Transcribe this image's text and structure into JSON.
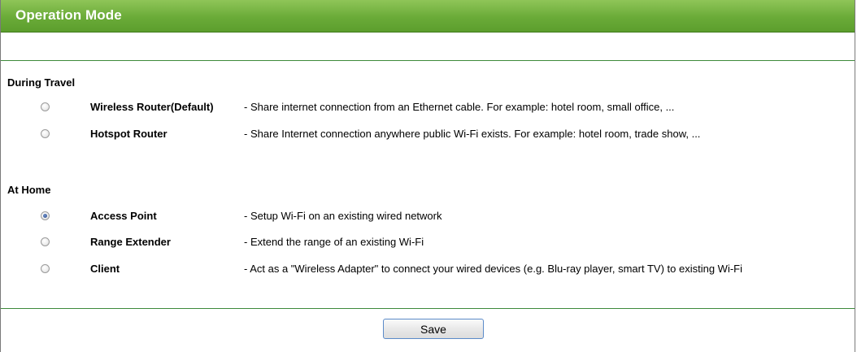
{
  "header": {
    "title": "Operation Mode"
  },
  "sections": [
    {
      "label": "During Travel",
      "options": [
        {
          "name": "Wireless Router(Default)",
          "description": "- Share internet connection from an Ethernet cable. For example: hotel room, small office, ...",
          "selected": false
        },
        {
          "name": "Hotspot Router",
          "description": "- Share Internet connection anywhere public Wi-Fi exists. For example: hotel room, trade show, ...",
          "selected": false
        }
      ]
    },
    {
      "label": "At Home",
      "options": [
        {
          "name": "Access Point",
          "description": "- Setup Wi-Fi on an existing wired network",
          "selected": true
        },
        {
          "name": "Range Extender",
          "description": "- Extend the range of an existing Wi-Fi",
          "selected": false
        },
        {
          "name": "Client",
          "description": "- Act as a \"Wireless Adapter\" to connect your wired devices (e.g. Blu-ray player, smart TV) to existing Wi-Fi",
          "selected": false
        }
      ]
    }
  ],
  "actions": {
    "save_label": "Save"
  },
  "colors": {
    "header_green": "#6aab38",
    "rule_green": "#3d8a3a",
    "button_border": "#5b8bc9",
    "radio_selected": "#2b4c8c"
  }
}
